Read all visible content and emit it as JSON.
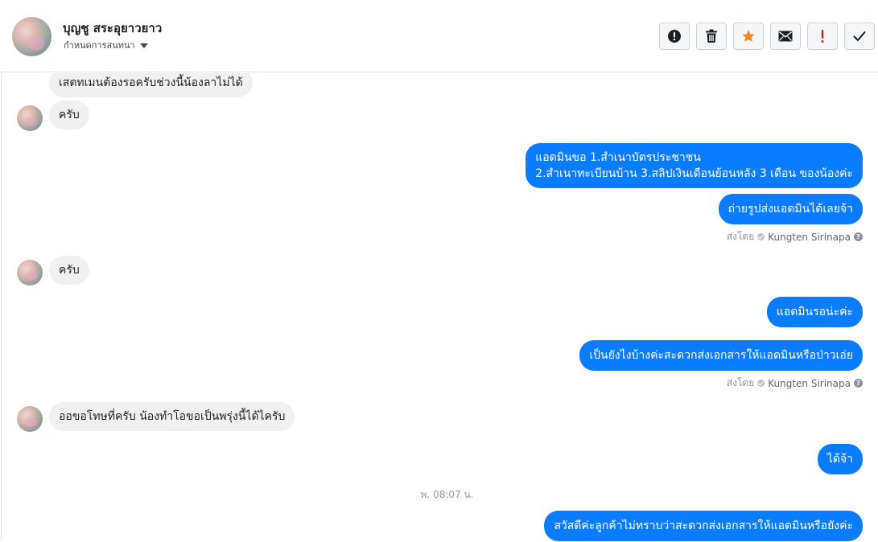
{
  "header": {
    "contact_name": "บุญชู สระอุยาวยาว",
    "subtitle": "กำหนดการสนทนา"
  },
  "toolbar": {
    "buttons": [
      {
        "icon": "alert-circle-icon",
        "color": "#1c1e21"
      },
      {
        "icon": "trash-icon",
        "color": "#1c1e21"
      },
      {
        "icon": "star-icon",
        "color": "#f5821f"
      },
      {
        "icon": "envelope-icon",
        "color": "#1c1e21"
      },
      {
        "icon": "exclamation-icon",
        "color": "#e02020"
      },
      {
        "icon": "checkmark-icon",
        "color": "#1c1e21"
      }
    ]
  },
  "messages": {
    "m1": "เสตทเมนต้องรอครับช่วงนี้น้องลาไม่ได้",
    "m2": "ครับ",
    "m3_line1": "แอดมินขอ  1.สำเนาบัตรประชาชน",
    "m3_line2": "2.สำเนาทะเบียนบ้าน 3.สลิปเงินเดือนย้อนหลัง 3 เดือน ของน้องค่ะ",
    "m4": "ถ่ายรูปส่งแอดมินได้เลยจ้า",
    "m5": "ครับ",
    "m6": "แอดมินรอน่ะค่ะ",
    "m7": "เป็นยังไงบ้างค่ะสะดวกส่งเอกสารให้แอดมินหรือป่าวเอ่ย",
    "m8": "ออขอโทษที่ครับ น้องทำโอขอเป็นพรุ่งนี้ได้ไครับ",
    "m9": "ได้จ้า",
    "m10": "สวัสดีค่ะลูกค้าไม่ทราบว่าสะดวกส่งเอกสารให้แอดมินหรือยังค่ะ"
  },
  "sent_by": {
    "prefix": "ส่งโดย",
    "name": "Kungten Sirinapa",
    "help": "?"
  },
  "timestamp": "พ. 08:07 น.",
  "colors": {
    "outgoing_bubble": "#0a7cff",
    "incoming_bubble": "#f1f0f0"
  }
}
